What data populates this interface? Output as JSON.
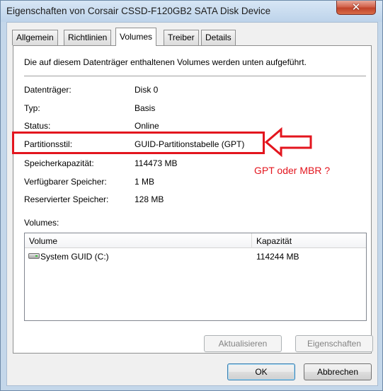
{
  "window": {
    "title": "Eigenschaften von Corsair CSSD-F120GB2 SATA Disk Device",
    "close_symbol": "✕"
  },
  "tabs": [
    {
      "label": "Allgemein",
      "active": false
    },
    {
      "label": "Richtlinien",
      "active": false
    },
    {
      "label": "Volumes",
      "active": true
    },
    {
      "label": "Treiber",
      "active": false
    },
    {
      "label": "Details",
      "active": false
    }
  ],
  "panel": {
    "description": "Die auf diesem Datenträger enthaltenen Volumes werden unten aufgeführt.",
    "properties": [
      {
        "label": "Datenträger:",
        "value": "Disk 0"
      },
      {
        "label": "Typ:",
        "value": "Basis"
      },
      {
        "label": "Status:",
        "value": "Online"
      },
      {
        "label": "Partitionsstil:",
        "value": "GUID-Partitionstabelle (GPT)"
      },
      {
        "label": "Speicherkapazität:",
        "value": "114473 MB"
      },
      {
        "label": "Verfügbarer Speicher:",
        "value": "1 MB"
      },
      {
        "label": "Reservierter Speicher:",
        "value": "128 MB"
      }
    ],
    "volumes_label": "Volumes:",
    "volumes_table": {
      "columns": [
        "Volume",
        "Kapazität"
      ],
      "rows": [
        {
          "icon": "drive-icon",
          "volume": "System GUID (C:)",
          "capacity": "114244 MB"
        }
      ]
    },
    "buttons": {
      "refresh": "Aktualisieren",
      "properties": "Eigenschaften"
    }
  },
  "footer": {
    "ok": "OK",
    "cancel": "Abbrechen"
  },
  "annotation": {
    "text": "GPT oder MBR ?",
    "color": "#e3151e"
  }
}
